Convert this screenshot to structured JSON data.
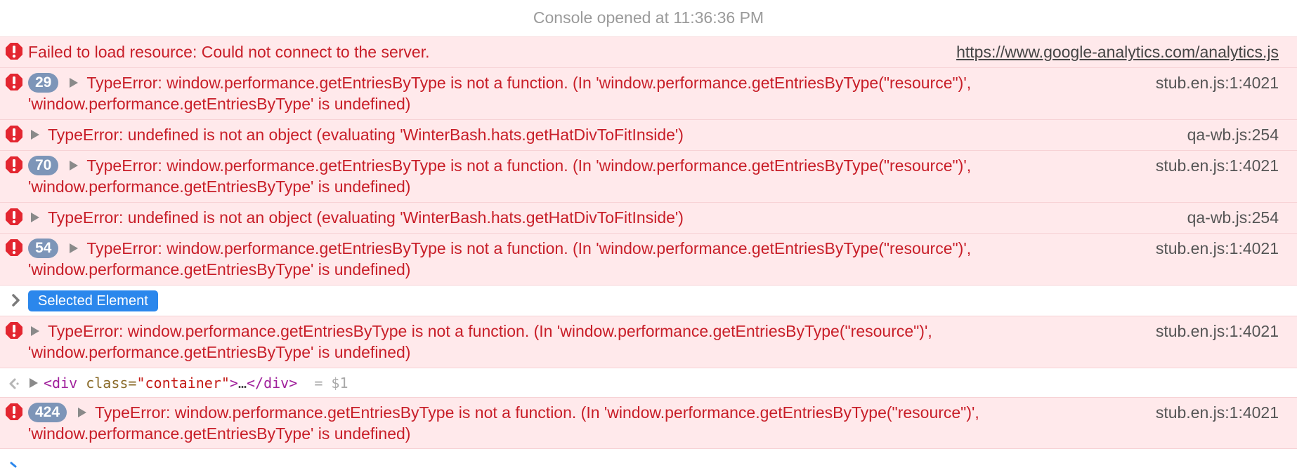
{
  "header": {
    "text": "Console opened at 11:36:36 PM"
  },
  "colors": {
    "error_text": "#c81e28",
    "error_bg": "#ffe9eb",
    "badge": "#7d95b8",
    "selected_badge": "#2b87ec"
  },
  "messages": [
    {
      "type": "error",
      "icon": "error-icon",
      "text": "Failed to load resource: Could not connect to the server.",
      "source": "https://www.google-analytics.com/analytics.js"
    },
    {
      "type": "error",
      "icon": "error-icon",
      "count": "29",
      "line1": "TypeError: window.performance.getEntriesByType is not a function. (In 'window.performance.getEntriesByType(\"resource\")',",
      "line2": "'window.performance.getEntriesByType' is undefined)",
      "source": "stub.en.js:1:4021"
    },
    {
      "type": "error",
      "icon": "error-icon",
      "text": "TypeError: undefined is not an object (evaluating 'WinterBash.hats.getHatDivToFitInside')",
      "source": "qa-wb.js:254"
    },
    {
      "type": "error",
      "icon": "error-icon",
      "count": "70",
      "line1": "TypeError: window.performance.getEntriesByType is not a function. (In 'window.performance.getEntriesByType(\"resource\")',",
      "line2": "'window.performance.getEntriesByType' is undefined)",
      "source": "stub.en.js:1:4021"
    },
    {
      "type": "error",
      "icon": "error-icon",
      "text": "TypeError: undefined is not an object (evaluating 'WinterBash.hats.getHatDivToFitInside')",
      "source": "qa-wb.js:254"
    },
    {
      "type": "error",
      "icon": "error-icon",
      "count": "54",
      "line1": "TypeError: window.performance.getEntriesByType is not a function. (In 'window.performance.getEntriesByType(\"resource\")',",
      "line2": "'window.performance.getEntriesByType' is undefined)",
      "source": "stub.en.js:1:4021"
    },
    {
      "type": "selected",
      "label": "Selected Element"
    },
    {
      "type": "error",
      "icon": "error-icon",
      "line1": "TypeError: window.performance.getEntriesByType is not a function. (In 'window.performance.getEntriesByType(\"resource\")',",
      "line2": "'window.performance.getEntriesByType' is undefined)",
      "source": "stub.en.js:1:4021"
    },
    {
      "type": "result",
      "tag_open": "<div",
      "attr_name": " class=",
      "attr_value": "\"container\"",
      "tag_mid": ">",
      "ellipsis": "…",
      "tag_close": "</div>",
      "assign": "  = $1"
    },
    {
      "type": "error",
      "icon": "error-icon",
      "count": "424",
      "line1": "TypeError: window.performance.getEntriesByType is not a function. (In 'window.performance.getEntriesByType(\"resource\")',",
      "line2": "'window.performance.getEntriesByType' is undefined)",
      "source": "stub.en.js:1:4021"
    }
  ]
}
